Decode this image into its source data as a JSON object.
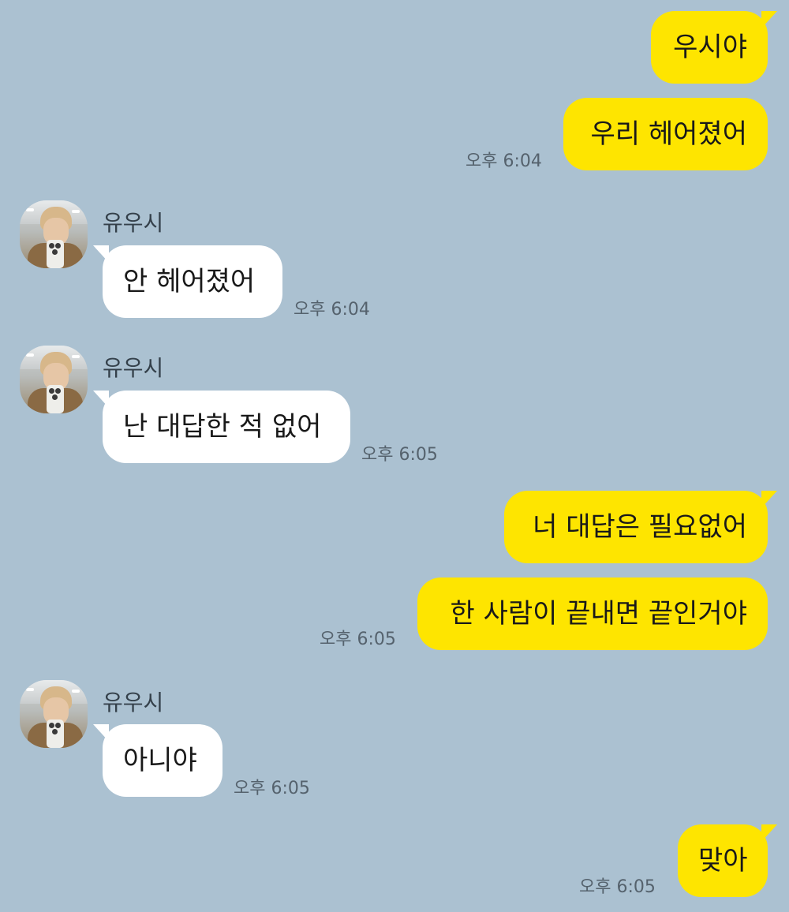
{
  "chat": {
    "contact_name": "유우시",
    "messages": [
      {
        "from": "me",
        "text": "우시야"
      },
      {
        "from": "me",
        "text": "우리 헤어졌어",
        "time": "오후 6:04"
      },
      {
        "from": "them",
        "sender": "유우시",
        "text": "안 헤어졌어",
        "time": "오후 6:04"
      },
      {
        "from": "them",
        "sender": "유우시",
        "text": "난 대답한 적 없어",
        "time": "오후 6:05"
      },
      {
        "from": "me",
        "text": "너 대답은 필요없어"
      },
      {
        "from": "me",
        "text": "한 사람이 끝내면 끝인거야",
        "time": "오후 6:05"
      },
      {
        "from": "them",
        "sender": "유우시",
        "text": "아니야",
        "time": "오후 6:05"
      },
      {
        "from": "me",
        "text": "맞아",
        "time": "오후 6:05"
      }
    ]
  },
  "colors": {
    "background": "#abc1d1",
    "my_bubble": "#fee500",
    "their_bubble": "#ffffff",
    "text": "#191919",
    "timestamp": "#55626d"
  }
}
